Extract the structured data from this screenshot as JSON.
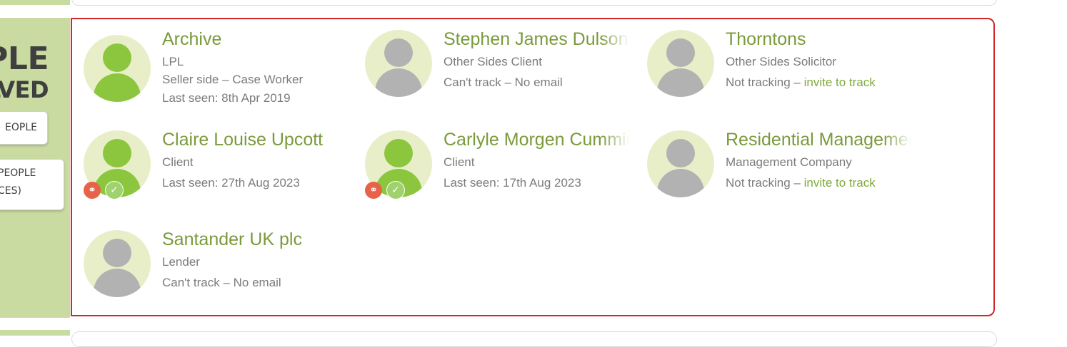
{
  "side_panel": {
    "title_line1": "PLE",
    "title_line2": "LVED",
    "button1_label": "EOPLE",
    "button2_line1": "PEOPLE",
    "button2_line2": "CES)"
  },
  "colors": {
    "accent_green": "#8cc63f",
    "name_green": "#7a9a3a",
    "panel_green": "#c9dba0",
    "highlight_border": "#d32626",
    "link_badge": "#e8624a",
    "check_badge": "#9fd16c"
  },
  "people": [
    {
      "name": "Archive",
      "lines": [
        "LPL",
        "Seller side – Case Worker",
        "Last seen: 8th Apr 2019"
      ],
      "avatar": "green",
      "badges": []
    },
    {
      "name": "Stephen James Dulson",
      "lines": [
        "Other Sides Client",
        "Can't track – No email"
      ],
      "avatar": "grey",
      "badges": []
    },
    {
      "name": "Thorntons",
      "lines": [
        "Other Sides Solicitor",
        "Not tracking – "
      ],
      "invite": "invite to track",
      "avatar": "grey",
      "badges": []
    },
    {
      "name": "Claire Louise Upcott",
      "lines": [
        "Client",
        "Last seen: 27th Aug 2023"
      ],
      "avatar": "green",
      "badges": [
        "link-icon",
        "check-icon"
      ]
    },
    {
      "name": "Carlyle Morgen Cumming",
      "lines": [
        "Client",
        "Last seen: 17th Aug 2023"
      ],
      "avatar": "green",
      "badges": [
        "link-icon",
        "check-icon"
      ]
    },
    {
      "name": "Residential Management",
      "lines": [
        "Management Company",
        "Not tracking – "
      ],
      "invite": "invite to track",
      "avatar": "grey",
      "badges": []
    },
    {
      "name": "Santander UK plc",
      "lines": [
        "Lender",
        "Can't track – No email"
      ],
      "avatar": "grey",
      "badges": []
    }
  ]
}
